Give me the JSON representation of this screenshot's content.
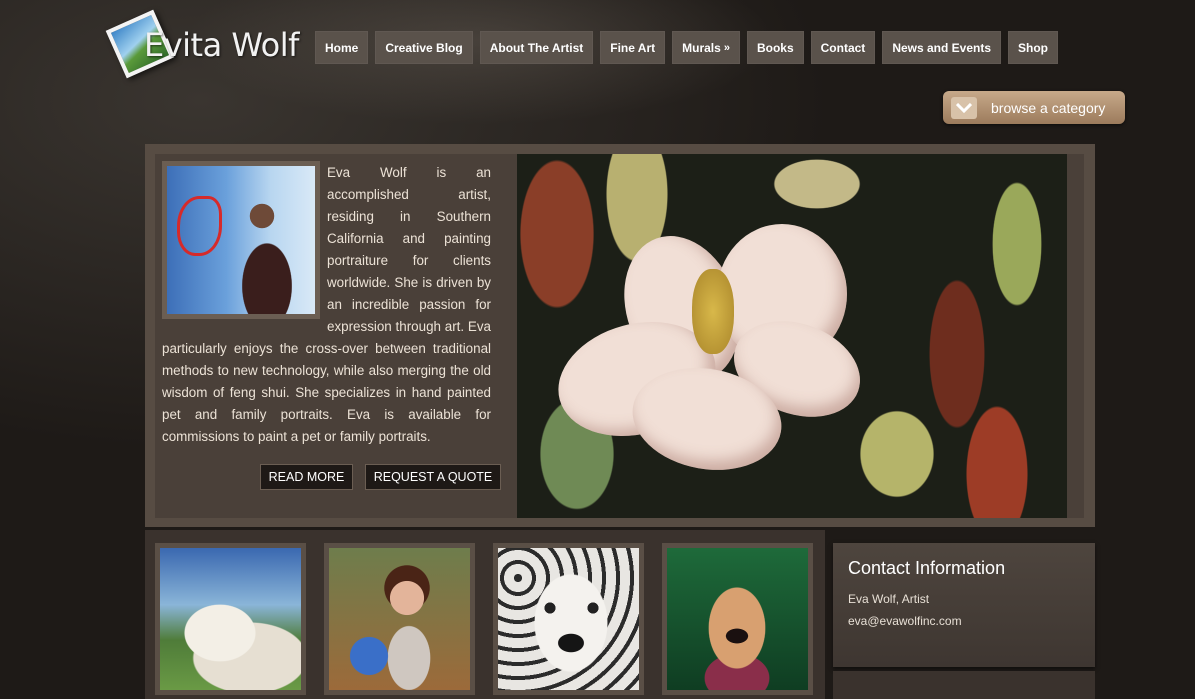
{
  "site": {
    "logo_text": "Evita Wolf",
    "logo_icon": "photo-frame-icon"
  },
  "nav": [
    {
      "label": "Home"
    },
    {
      "label": "Creative Blog"
    },
    {
      "label": "About The Artist"
    },
    {
      "label": "Fine Art"
    },
    {
      "label": "Murals",
      "submenu_indicator": "»"
    },
    {
      "label": "Books"
    },
    {
      "label": "Contact"
    },
    {
      "label": "News and Events"
    },
    {
      "label": "Shop"
    }
  ],
  "browse": {
    "label": "browse a category",
    "icon": "chevron-down-icon"
  },
  "intro": {
    "bio": "Eva Wolf is an accomplished artist, residing in Southern California and painting portraiture for clients worldwide. She is driven by an incredible passion for expression through art. Eva particularly enjoys the cross-over between traditional methods to new technology, while also merging the old wisdom of feng shui. She specializes in hand painted pet and family portraits. Eva is available for commissions to paint a pet or family portraits.",
    "read_more_label": "READ MORE",
    "request_quote_label": "REQUEST A QUOTE"
  },
  "contact": {
    "title": "Contact Information",
    "name": "Eva Wolf, Artist",
    "email": "eva@evawolfinc.com"
  },
  "colors": {
    "background": "#221e1b",
    "nav_button": "#5a524b",
    "panel": "#4a4039",
    "browse_button": "#b39374",
    "button_dark": "#1e1916"
  }
}
